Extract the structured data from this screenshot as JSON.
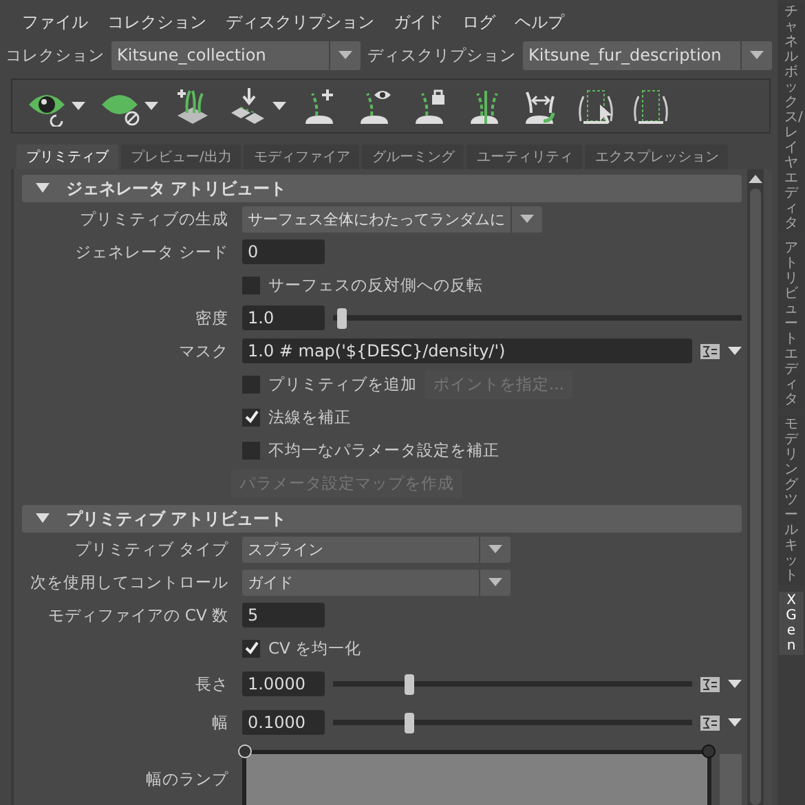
{
  "menu": [
    "ファイル",
    "コレクション",
    "ディスクリプション",
    "ガイド",
    "ログ",
    "ヘルプ"
  ],
  "selectors": [
    {
      "label": "コレクション",
      "value": "Kitsune_collection"
    },
    {
      "label": "ディスクリプション",
      "value": "Kitsune_fur_description"
    }
  ],
  "toolbar": [
    {
      "kind": "eye",
      "dropdown": true
    },
    {
      "kind": "leaf",
      "dropdown": true
    },
    {
      "kind": "grass",
      "dropdown": false
    },
    {
      "kind": "plane",
      "dropdown": true
    },
    {
      "kind": "curve_plus",
      "dropdown": false
    },
    {
      "kind": "curve_eye",
      "dropdown": false
    },
    {
      "kind": "curve_lock",
      "dropdown": false
    },
    {
      "kind": "curve_pair",
      "dropdown": false
    },
    {
      "kind": "curve_arrow",
      "dropdown": false
    },
    {
      "kind": "frame_cursor",
      "dropdown": false
    },
    {
      "kind": "frame",
      "dropdown": false
    }
  ],
  "tabs": [
    {
      "label": "プリミティブ",
      "selected": true
    },
    {
      "label": "プレビュー/出力",
      "selected": false
    },
    {
      "label": "モディファイア",
      "selected": false
    },
    {
      "label": "グルーミング",
      "selected": false
    },
    {
      "label": "ユーティリティ",
      "selected": false
    },
    {
      "label": "エクスプレッション",
      "selected": false
    }
  ],
  "sections": [
    {
      "title": "ジェネレータ アトリビュート",
      "expanded": true,
      "rows": [
        {
          "kind": "dropdown",
          "label": "プリミティブの生成",
          "value": "サーフェス全体にわたってランダムに"
        },
        {
          "kind": "field",
          "label": "ジェネレータ シード",
          "value": "0"
        },
        {
          "kind": "checkbox",
          "label": "サーフェスの反対側への反転",
          "checked": false
        },
        {
          "kind": "slider",
          "label": "密度",
          "value": "1.0",
          "level": 0.02
        },
        {
          "kind": "expression",
          "label": "マスク",
          "value": "1.0 # map('${DESC}/density/')"
        },
        {
          "kind": "checkbox",
          "label": "プリミティブを追加",
          "checked": false,
          "button": {
            "label": "ポイントを指定...",
            "disabled": true
          }
        },
        {
          "kind": "checkbox",
          "label": "法線を補正",
          "checked": true
        },
        {
          "kind": "checkbox",
          "label": "不均一なパラメータ設定を補正",
          "checked": false
        },
        {
          "kind": "button",
          "label": "パラメータ設定マップを作成",
          "disabled": true
        }
      ]
    },
    {
      "title": "プリミティブ アトリビュート",
      "expanded": true,
      "rows": [
        {
          "kind": "dropdown",
          "label": "プリミティブ タイプ",
          "value": "スプライン"
        },
        {
          "kind": "dropdown",
          "label": "次を使用してコントロール",
          "value": "ガイド"
        },
        {
          "kind": "field",
          "label": "モディファイアの CV 数",
          "value": "5"
        },
        {
          "kind": "checkbox",
          "label": "CV を均一化",
          "checked": true
        },
        {
          "kind": "slider_expr",
          "label": "長さ",
          "value": "1.0000",
          "level": 0.21
        },
        {
          "kind": "slider_expr",
          "label": "幅",
          "value": "0.1000",
          "level": 0.21
        },
        {
          "kind": "ramp",
          "label": "幅のランプ"
        }
      ]
    }
  ],
  "side_tabs": [
    {
      "label": "チャネルボックス/レイヤエディタ",
      "selected": false
    },
    {
      "label": "アトリビュートエディタ",
      "selected": false
    },
    {
      "label": "モデリングツールキット",
      "selected": false
    },
    {
      "label": "XGen",
      "selected": true
    }
  ]
}
